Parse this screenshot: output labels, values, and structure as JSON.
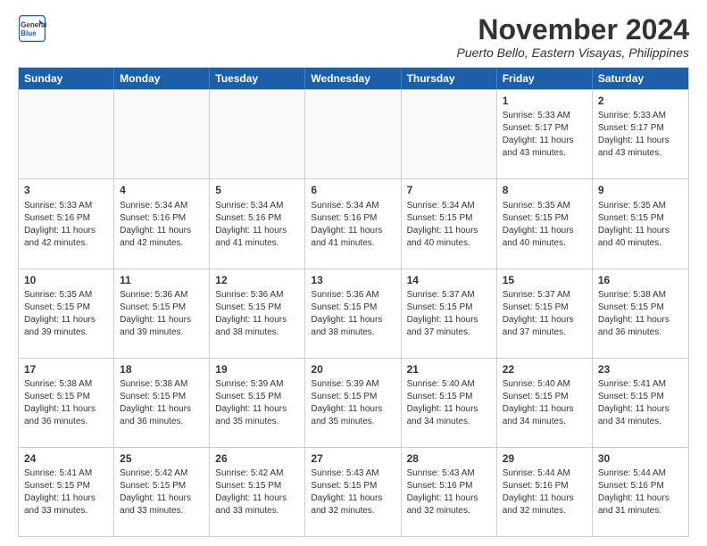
{
  "header": {
    "logo_line1": "General",
    "logo_line2": "Blue",
    "month": "November 2024",
    "location": "Puerto Bello, Eastern Visayas, Philippines"
  },
  "weekdays": [
    "Sunday",
    "Monday",
    "Tuesday",
    "Wednesday",
    "Thursday",
    "Friday",
    "Saturday"
  ],
  "rows": [
    [
      {
        "day": "",
        "detail": "",
        "empty": true
      },
      {
        "day": "",
        "detail": "",
        "empty": true
      },
      {
        "day": "",
        "detail": "",
        "empty": true
      },
      {
        "day": "",
        "detail": "",
        "empty": true
      },
      {
        "day": "",
        "detail": "",
        "empty": true
      },
      {
        "day": "1",
        "detail": "Sunrise: 5:33 AM\nSunset: 5:17 PM\nDaylight: 11 hours\nand 43 minutes.",
        "empty": false
      },
      {
        "day": "2",
        "detail": "Sunrise: 5:33 AM\nSunset: 5:17 PM\nDaylight: 11 hours\nand 43 minutes.",
        "empty": false
      }
    ],
    [
      {
        "day": "3",
        "detail": "Sunrise: 5:33 AM\nSunset: 5:16 PM\nDaylight: 11 hours\nand 42 minutes.",
        "empty": false
      },
      {
        "day": "4",
        "detail": "Sunrise: 5:34 AM\nSunset: 5:16 PM\nDaylight: 11 hours\nand 42 minutes.",
        "empty": false
      },
      {
        "day": "5",
        "detail": "Sunrise: 5:34 AM\nSunset: 5:16 PM\nDaylight: 11 hours\nand 41 minutes.",
        "empty": false
      },
      {
        "day": "6",
        "detail": "Sunrise: 5:34 AM\nSunset: 5:16 PM\nDaylight: 11 hours\nand 41 minutes.",
        "empty": false
      },
      {
        "day": "7",
        "detail": "Sunrise: 5:34 AM\nSunset: 5:15 PM\nDaylight: 11 hours\nand 40 minutes.",
        "empty": false
      },
      {
        "day": "8",
        "detail": "Sunrise: 5:35 AM\nSunset: 5:15 PM\nDaylight: 11 hours\nand 40 minutes.",
        "empty": false
      },
      {
        "day": "9",
        "detail": "Sunrise: 5:35 AM\nSunset: 5:15 PM\nDaylight: 11 hours\nand 40 minutes.",
        "empty": false
      }
    ],
    [
      {
        "day": "10",
        "detail": "Sunrise: 5:35 AM\nSunset: 5:15 PM\nDaylight: 11 hours\nand 39 minutes.",
        "empty": false
      },
      {
        "day": "11",
        "detail": "Sunrise: 5:36 AM\nSunset: 5:15 PM\nDaylight: 11 hours\nand 39 minutes.",
        "empty": false
      },
      {
        "day": "12",
        "detail": "Sunrise: 5:36 AM\nSunset: 5:15 PM\nDaylight: 11 hours\nand 38 minutes.",
        "empty": false
      },
      {
        "day": "13",
        "detail": "Sunrise: 5:36 AM\nSunset: 5:15 PM\nDaylight: 11 hours\nand 38 minutes.",
        "empty": false
      },
      {
        "day": "14",
        "detail": "Sunrise: 5:37 AM\nSunset: 5:15 PM\nDaylight: 11 hours\nand 37 minutes.",
        "empty": false
      },
      {
        "day": "15",
        "detail": "Sunrise: 5:37 AM\nSunset: 5:15 PM\nDaylight: 11 hours\nand 37 minutes.",
        "empty": false
      },
      {
        "day": "16",
        "detail": "Sunrise: 5:38 AM\nSunset: 5:15 PM\nDaylight: 11 hours\nand 36 minutes.",
        "empty": false
      }
    ],
    [
      {
        "day": "17",
        "detail": "Sunrise: 5:38 AM\nSunset: 5:15 PM\nDaylight: 11 hours\nand 36 minutes.",
        "empty": false
      },
      {
        "day": "18",
        "detail": "Sunrise: 5:38 AM\nSunset: 5:15 PM\nDaylight: 11 hours\nand 36 minutes.",
        "empty": false
      },
      {
        "day": "19",
        "detail": "Sunrise: 5:39 AM\nSunset: 5:15 PM\nDaylight: 11 hours\nand 35 minutes.",
        "empty": false
      },
      {
        "day": "20",
        "detail": "Sunrise: 5:39 AM\nSunset: 5:15 PM\nDaylight: 11 hours\nand 35 minutes.",
        "empty": false
      },
      {
        "day": "21",
        "detail": "Sunrise: 5:40 AM\nSunset: 5:15 PM\nDaylight: 11 hours\nand 34 minutes.",
        "empty": false
      },
      {
        "day": "22",
        "detail": "Sunrise: 5:40 AM\nSunset: 5:15 PM\nDaylight: 11 hours\nand 34 minutes.",
        "empty": false
      },
      {
        "day": "23",
        "detail": "Sunrise: 5:41 AM\nSunset: 5:15 PM\nDaylight: 11 hours\nand 34 minutes.",
        "empty": false
      }
    ],
    [
      {
        "day": "24",
        "detail": "Sunrise: 5:41 AM\nSunset: 5:15 PM\nDaylight: 11 hours\nand 33 minutes.",
        "empty": false
      },
      {
        "day": "25",
        "detail": "Sunrise: 5:42 AM\nSunset: 5:15 PM\nDaylight: 11 hours\nand 33 minutes.",
        "empty": false
      },
      {
        "day": "26",
        "detail": "Sunrise: 5:42 AM\nSunset: 5:15 PM\nDaylight: 11 hours\nand 33 minutes.",
        "empty": false
      },
      {
        "day": "27",
        "detail": "Sunrise: 5:43 AM\nSunset: 5:15 PM\nDaylight: 11 hours\nand 32 minutes.",
        "empty": false
      },
      {
        "day": "28",
        "detail": "Sunrise: 5:43 AM\nSunset: 5:16 PM\nDaylight: 11 hours\nand 32 minutes.",
        "empty": false
      },
      {
        "day": "29",
        "detail": "Sunrise: 5:44 AM\nSunset: 5:16 PM\nDaylight: 11 hours\nand 32 minutes.",
        "empty": false
      },
      {
        "day": "30",
        "detail": "Sunrise: 5:44 AM\nSunset: 5:16 PM\nDaylight: 11 hours\nand 31 minutes.",
        "empty": false
      }
    ]
  ]
}
